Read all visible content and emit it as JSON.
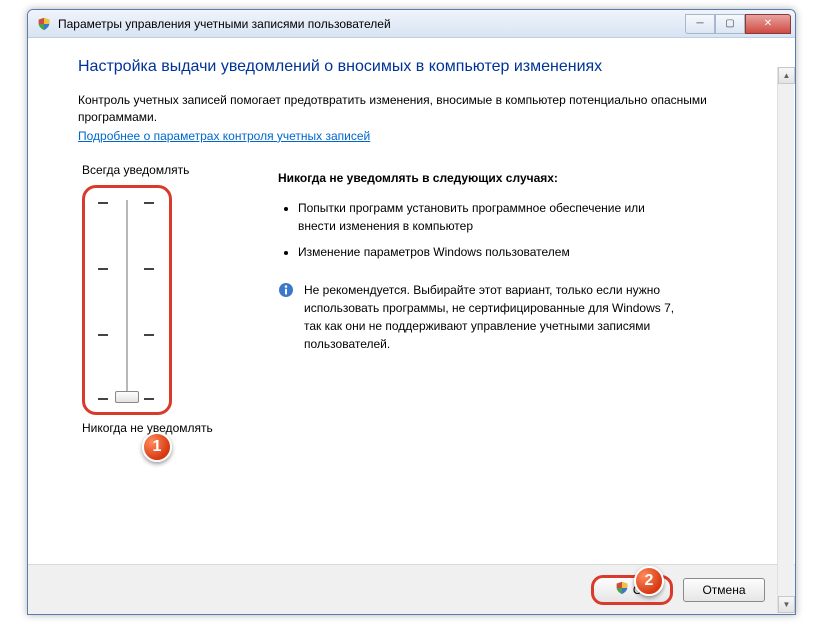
{
  "window": {
    "title": "Параметры управления учетными записями пользователей"
  },
  "content": {
    "heading": "Настройка выдачи уведомлений о вносимых в компьютер изменениях",
    "intro": "Контроль учетных записей помогает предотвратить изменения, вносимые в компьютер потенциально опасными программами.",
    "learn_more": "Подробнее о параметрах контроля учетных записей"
  },
  "slider": {
    "top_label": "Всегда уведомлять",
    "bottom_label": "Никогда не уведомлять",
    "level": 0
  },
  "description": {
    "heading": "Никогда не уведомлять в следующих случаях:",
    "bullets": [
      "Попытки программ установить программное обеспечение или внести изменения в компьютер",
      "Изменение параметров Windows пользователем"
    ],
    "info": "Не рекомендуется. Выбирайте этот вариант, только если нужно использовать программы, не сертифицированные для Windows 7, так как они не поддерживают управление учетными записями пользователей."
  },
  "buttons": {
    "ok": "ОК",
    "cancel": "Отмена"
  },
  "badges": {
    "b1": "1",
    "b2": "2"
  }
}
